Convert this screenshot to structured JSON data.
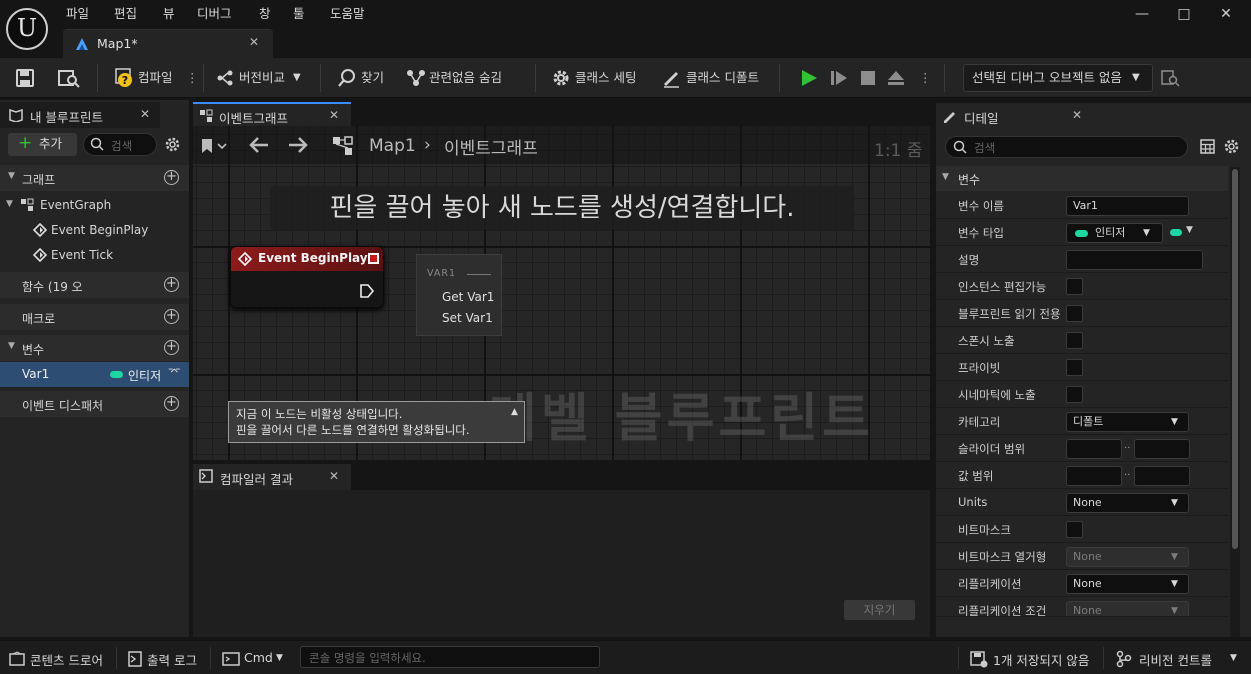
{
  "menu": [
    "파일",
    "편집",
    "뷰",
    "디버그",
    "창",
    "툴",
    "도움말"
  ],
  "doc_tab": {
    "label": "Map1*"
  },
  "toolbar": {
    "compile": "컴파일",
    "diff": "버전비교",
    "find": "찾기",
    "hide_unrelated": "관련없음 숨김",
    "class_settings": "클래스 세팅",
    "class_defaults": "클래스 디폴트",
    "debug_object": "선택된 디버그 오브젝트 없음"
  },
  "my_blueprint": {
    "tab": "내 블루프린트",
    "add": "추가",
    "search_placeholder": "검색",
    "sections": {
      "graphs": "그래프",
      "functions": "함수 (19 오",
      "macros": "매크로",
      "variables": "변수",
      "dispatchers": "이벤트 디스패처"
    },
    "event_graph": "EventGraph",
    "events": [
      "Event BeginPlay",
      "Event Tick"
    ],
    "var": {
      "name": "Var1",
      "type": "인티저",
      "type_color": "#1ed8a3"
    }
  },
  "graph_editor": {
    "tab": "이벤트그래프",
    "crumb_root": "Map1",
    "crumb_leaf": "이벤트그래프",
    "zoom": "1:1 줌",
    "hint": "핀을 끌어 놓아 새 노드를 생성/연결합니다.",
    "watermark": "레벨 블루프린트",
    "node_title": "Event BeginPlay",
    "popup": {
      "header": "VAR1",
      "items": [
        "Get Var1",
        "Set Var1"
      ]
    },
    "tooltip": [
      "지금 이 노드는 비활성 상태입니다.",
      "핀을 끌어서 다른 노드를 연결하면 활성화됩니다."
    ]
  },
  "compiler": {
    "tab": "컴파일러 결과",
    "clear": "지우기"
  },
  "details": {
    "tab": "디테일",
    "search_placeholder": "검색",
    "section": "변수",
    "rows": {
      "name": "변수 이름",
      "type": "변수 타입",
      "desc": "설명",
      "instance_editable": "인스턴스 편집가능",
      "bp_readonly": "블루프린트 읽기 전용",
      "expose_spawn": "스폰시 노출",
      "private": "프라이빗",
      "expose_cine": "시네마틱에 노출",
      "category": "카테고리",
      "slider_range": "슬라이더 범위",
      "value_range": "값 범위",
      "units": "Units",
      "bitmask": "비트마스크",
      "bitmask_enum": "비트마스크 열거형",
      "replication": "리플리케이션",
      "rep_condition": "리플리케이션 조건"
    },
    "values": {
      "name": "Var1",
      "type": "인티저",
      "category": "디폴트",
      "units": "None",
      "bitmask_enum": "None",
      "replication": "None",
      "rep_condition": "None",
      "range_sep": ".."
    }
  },
  "statusbar": {
    "content_drawer": "콘텐츠 드로어",
    "output_log": "출력 로그",
    "cmd": "Cmd",
    "console_placeholder": "콘솔 명령을 입력하세요.",
    "unsaved": "1개 저장되지 않음",
    "revision": "리비전 컨트롤"
  },
  "colors": {
    "accent_green": "#35c135",
    "pin_teal": "#1ed8a3",
    "node_red": "#8e1b1b",
    "selected_row": "#2d4d73"
  }
}
